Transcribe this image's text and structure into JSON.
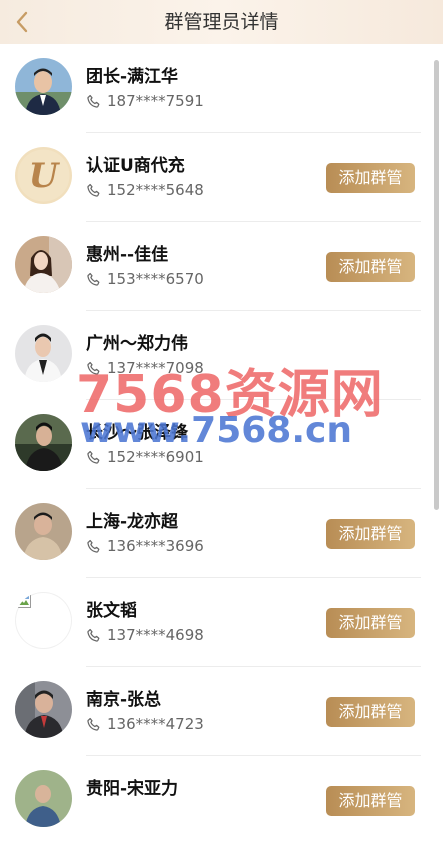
{
  "header": {
    "title": "群管理员详情",
    "back_icon": "chevron-left-icon"
  },
  "button_label": "添加群管",
  "accent": {
    "button_start": "#b88d55",
    "button_end": "#d7b57f",
    "back": "#c79c64"
  },
  "members": [
    {
      "name": "团长-满江华",
      "phone": "187****7591",
      "has_button": false,
      "avatar": "person-photo"
    },
    {
      "name": "认证U商代充",
      "phone": "152****5648",
      "has_button": true,
      "avatar": "letter-u-logo"
    },
    {
      "name": "惠州--佳佳",
      "phone": "153****6570",
      "has_button": true,
      "avatar": "person-photo"
    },
    {
      "name": "广州～郑力伟",
      "phone": "137****7098",
      "has_button": false,
      "avatar": "person-photo"
    },
    {
      "name": "长沙～张泽锋",
      "phone": "152****6901",
      "has_button": false,
      "avatar": "person-photo"
    },
    {
      "name": "上海-龙亦超",
      "phone": "136****3696",
      "has_button": true,
      "avatar": "person-photo"
    },
    {
      "name": "张文韬",
      "phone": "137****4698",
      "has_button": true,
      "avatar": "broken-image"
    },
    {
      "name": "南京-张总",
      "phone": "136****4723",
      "has_button": true,
      "avatar": "person-photo"
    },
    {
      "name": "贵阳-宋亚力",
      "phone": "",
      "has_button": true,
      "avatar": "person-photo"
    }
  ],
  "watermark": {
    "line1": "7568资源网",
    "line2": "www.7568.cn"
  }
}
